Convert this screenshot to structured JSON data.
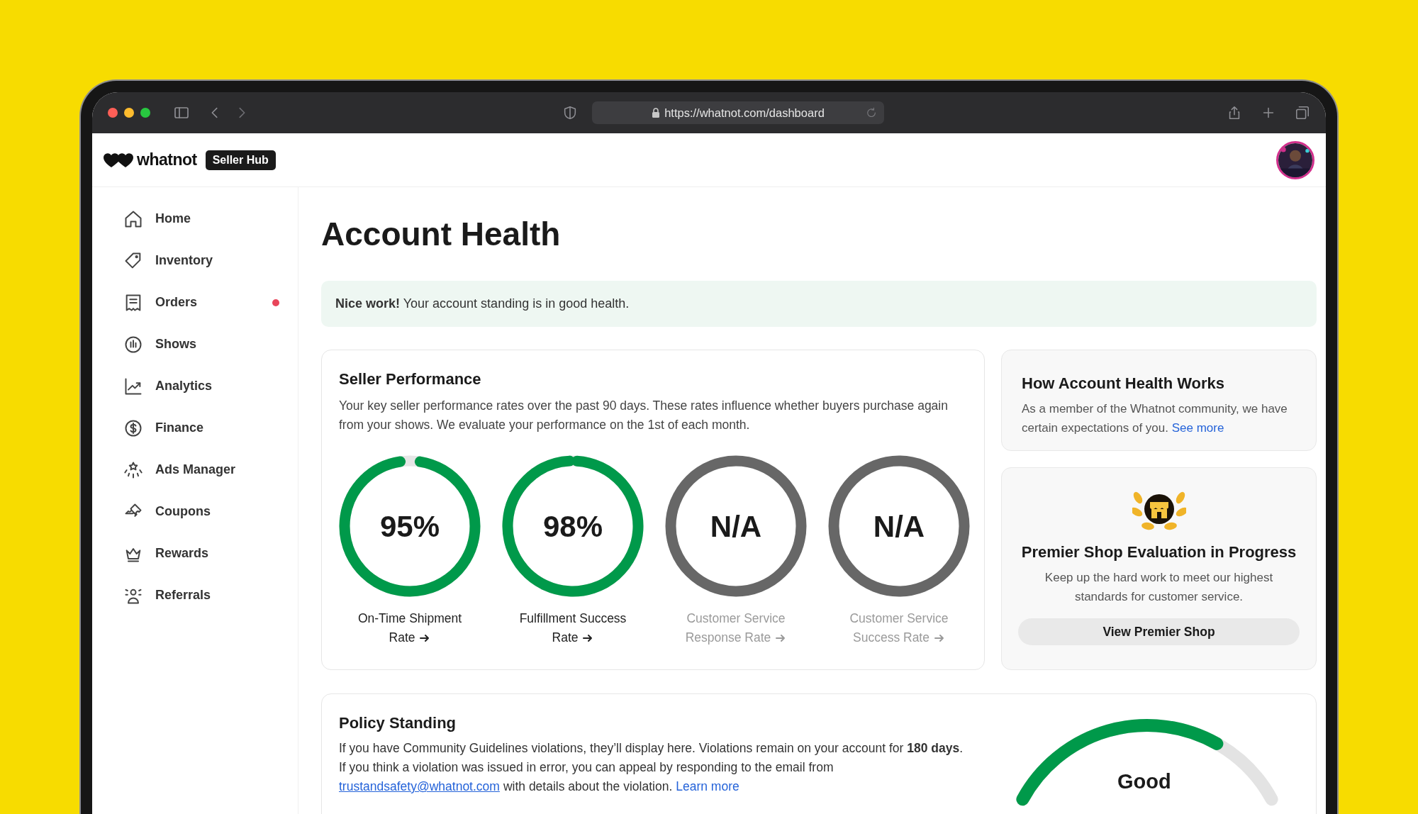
{
  "browser": {
    "url": "https://whatnot.com/dashboard"
  },
  "header": {
    "logo": "whatnot",
    "badge": "Seller Hub"
  },
  "sidebar": {
    "items": [
      {
        "label": "Home",
        "notification": false
      },
      {
        "label": "Inventory",
        "notification": false
      },
      {
        "label": "Orders",
        "notification": true,
        "color": "#e8455a"
      },
      {
        "label": "Shows",
        "notification": false
      },
      {
        "label": "Analytics",
        "notification": false
      },
      {
        "label": "Finance",
        "notification": false
      },
      {
        "label": "Ads Manager",
        "notification": false
      },
      {
        "label": "Coupons",
        "notification": false
      },
      {
        "label": "Rewards",
        "notification": false
      },
      {
        "label": "Referrals",
        "notification": false
      }
    ]
  },
  "page_title": "Account Health",
  "banner": {
    "text": "**Nice work!** Your account standing is in good health."
  },
  "seller_performance": {
    "title": "Seller Performance",
    "description": "Your key seller performance rates over the past 90 days. These rates influence whether buyers purchase again from your shows. We evaluate your performance on the 1st of each month.",
    "metrics": [
      {
        "kind": "rated",
        "value": "95%",
        "level": 0.95,
        "label_lines": [
          "On-Time Shipment",
          "Rate"
        ],
        "disabled": false
      },
      {
        "kind": "rated",
        "value": "98%",
        "level": 0.98,
        "label_lines": [
          "Fulfillment Success",
          "Rate"
        ],
        "disabled": false
      },
      {
        "kind": "na",
        "value": "N/A",
        "label_lines": [
          "Customer Service",
          "Response Rate"
        ],
        "disabled": true
      },
      {
        "kind": "na",
        "value": "N/A",
        "label_lines": [
          "Customer Service",
          "Success Rate"
        ],
        "disabled": true
      }
    ]
  },
  "how_it_works": {
    "title": "How Account Health Works",
    "text": "As a member of the Whatnot community, we have certain expectations of you.",
    "link": "See more"
  },
  "premier": {
    "title": "Premier Shop Evaluation in Progress",
    "text": "Keep up the hard work to meet our highest standards for customer service.",
    "button": "View Premier Shop"
  },
  "policy": {
    "title": "Policy Standing",
    "line_1": "If you have Community Guidelines violations, they’ll display here. Violations remain on your account for **180 days**.",
    "line_2": "If you think a violation was issued in error, you can appeal by responding to the email from",
    "email": "trustandsafety@whatnot.com",
    "line_3": "with details about the violation.",
    "link": "Learn more",
    "gauge": {
      "label": "Good",
      "level": 0.74
    }
  }
}
